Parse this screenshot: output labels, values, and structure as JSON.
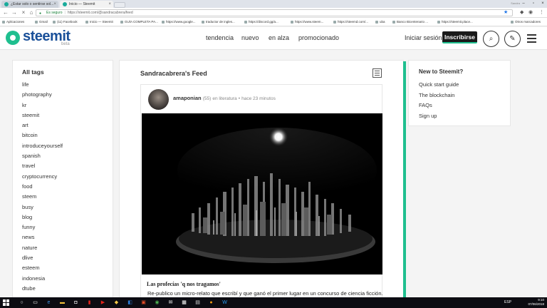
{
  "browser": {
    "tabs": [
      {
        "label": "¿Estar solo o sentirse sol...",
        "active": false
      },
      {
        "label": "Inicio — Steemit",
        "active": true
      }
    ],
    "profile_name": "Sandra",
    "url_secure_label": "Es seguro",
    "url": "https://steemit.com/@sandracabrera/feed",
    "bookmarks": [
      "Aplicaciones",
      "Gmail",
      "(11) Facebook",
      "Inicio — Steemit",
      "GUÍA COMPLETA PA...",
      "https://www.google...",
      "traductor de ingles...",
      "https://discord.gg/a...",
      "https://www.steem...",
      "https://steemd.com/...",
      "uba",
      "Banco Bicentenario ...",
      "https://steemit.place...",
      "Otros marcadores"
    ]
  },
  "site": {
    "logo": "steemit",
    "beta": "beta",
    "nav": [
      "tendencia",
      "nuevo",
      "en alza",
      "promocionado"
    ],
    "login": "Iniciar sesión",
    "signup": "Inscribirse"
  },
  "sidebar": {
    "title": "All tags",
    "tags": [
      "life",
      "photography",
      "kr",
      "steemit",
      "art",
      "bitcoin",
      "introduceyourself",
      "spanish",
      "travel",
      "cryptocurrency",
      "food",
      "steem",
      "busy",
      "blog",
      "funny",
      "news",
      "nature",
      "dlive",
      "esteem",
      "indonesia",
      "dtube"
    ]
  },
  "feed": {
    "title": "Sandracabrera's Feed",
    "post": {
      "author": "amaponian",
      "reputation": "(55)",
      "category_text": "en literatura",
      "time_text": "hace 23 minutos",
      "title": "Las profecías 'q nos tragamos'",
      "excerpt": "Re-publico un micro-relato que escribí y que ganó el primer lugar en un concurso de ciencia ficción."
    }
  },
  "newto": {
    "title": "New to Steemit?",
    "links": [
      "Quick start guide",
      "The blockchain",
      "FAQs",
      "Sign up"
    ]
  },
  "taskbar": {
    "lang": "ESP",
    "time": "9:10",
    "date": "07/06/2018"
  },
  "colors": {
    "brand_green": "#1fbf8f",
    "brand_blue": "#1a5099"
  }
}
